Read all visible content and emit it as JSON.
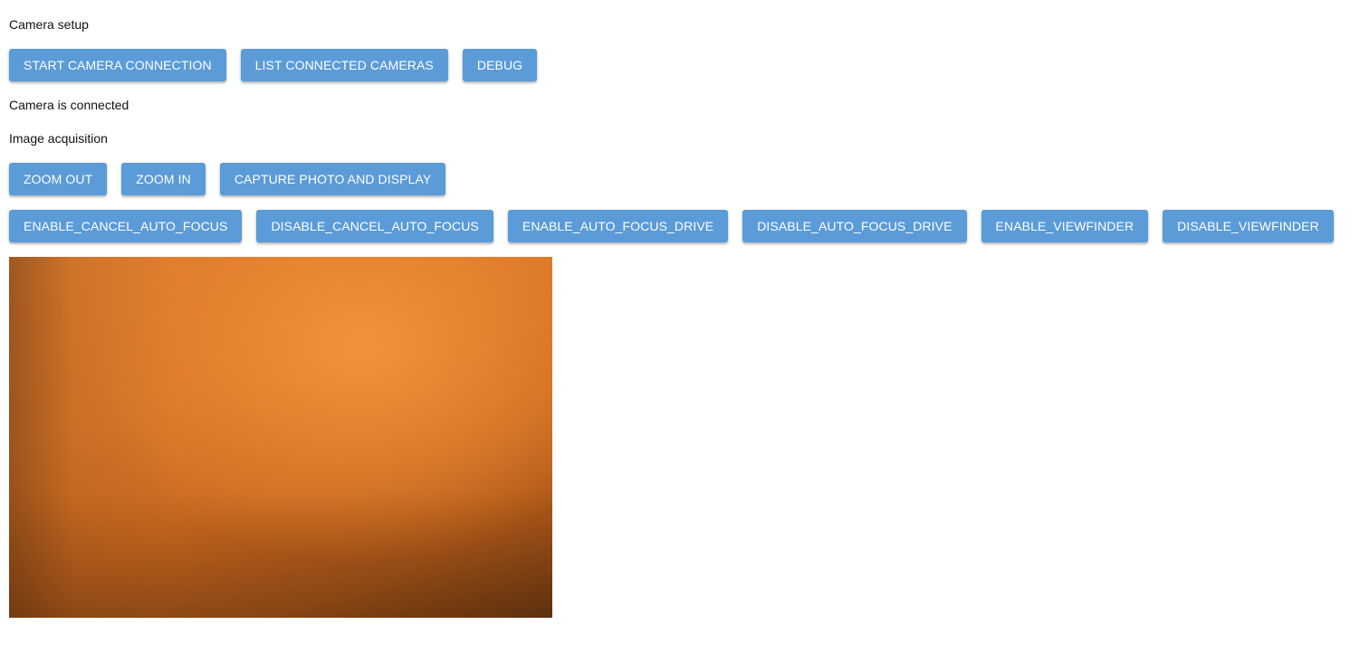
{
  "sections": {
    "setup_title": "Camera setup",
    "status_text": "Camera is connected",
    "acquisition_title": "Image acquisition"
  },
  "setup_buttons": {
    "start": "START CAMERA CONNECTION",
    "list": "LIST CONNECTED CAMERAS",
    "debug": "DEBUG"
  },
  "acquisition_buttons": {
    "zoom_out": "ZOOM OUT",
    "zoom_in": "ZOOM IN",
    "capture": "CAPTURE PHOTO AND DISPLAY"
  },
  "control_buttons": {
    "enable_cancel_af": "ENABLE_CANCEL_AUTO_FOCUS",
    "disable_cancel_af": "DISABLE_CANCEL_AUTO_FOCUS",
    "enable_af_drive": "ENABLE_AUTO_FOCUS_DRIVE",
    "disable_af_drive": "DISABLE_AUTO_FOCUS_DRIVE",
    "enable_viewfinder": "ENABLE_VIEWFINDER",
    "disable_viewfinder": "DISABLE_VIEWFINDER"
  },
  "colors": {
    "button_bg": "#5b9bd8",
    "button_text": "#ffffff",
    "photo_tone": "#e08434"
  }
}
